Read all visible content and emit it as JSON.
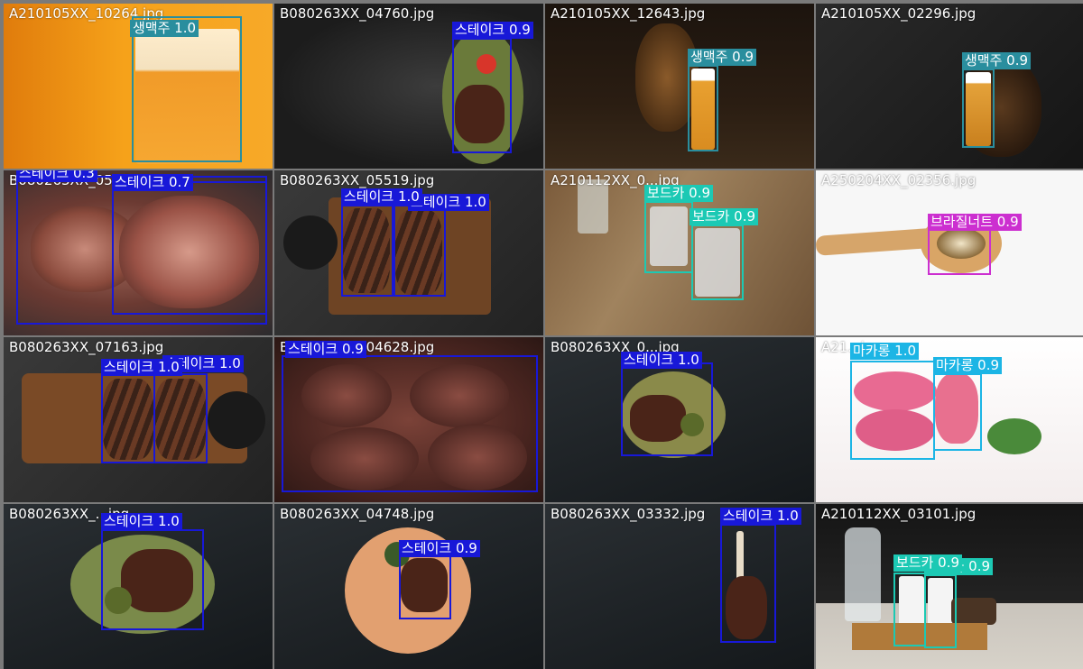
{
  "colors": {
    "beer": "#2a8e9e",
    "steak": "#1818d8",
    "vodka": "#1cc9b4",
    "brazilnut": "#cc2fd0",
    "macaron": "#1cb5e5"
  },
  "cells": [
    {
      "filename": "A210105XX_10264.jpg",
      "detections": [
        {
          "label": "생맥주 1.0"
        }
      ]
    },
    {
      "filename": "B080263XX_04760.jpg",
      "detections": [
        {
          "label": "스테이크 0.9"
        }
      ]
    },
    {
      "filename": "A210105XX_12643.jpg",
      "detections": [
        {
          "label": "생맥주 0.9"
        }
      ]
    },
    {
      "filename": "A210105XX_02296.jpg",
      "detections": [
        {
          "label": "생맥주 0.9"
        }
      ]
    },
    {
      "filename": "B080263XX_05...jpg",
      "detections": [
        {
          "label": "스테이크 0.3"
        },
        {
          "label": "스테이크 0.7"
        }
      ]
    },
    {
      "filename": "B080263XX_05519.jpg",
      "detections": [
        {
          "label": "스테이크 1.0"
        },
        {
          "label": "스테이크 1.0"
        }
      ]
    },
    {
      "filename": "A210112XX_0...jpg",
      "detections": [
        {
          "label": "보드카 0.9"
        },
        {
          "label": "보드카 0.9"
        }
      ]
    },
    {
      "filename": "A250204XX_02356.jpg",
      "detections": [
        {
          "label": "브라질너트 0.9"
        }
      ]
    },
    {
      "filename": "B080263XX_07163.jpg",
      "detections": [
        {
          "label": "스테이크 1.0"
        },
        {
          "label": "스테이크 1.0"
        }
      ]
    },
    {
      "filename": "B080263XX_04628.jpg",
      "detections": [
        {
          "label": "스테이크 0.9"
        }
      ]
    },
    {
      "filename": "B080263XX_0...jpg",
      "detections": [
        {
          "label": "스테이크 1.0"
        }
      ]
    },
    {
      "filename": "A21...jpg",
      "detections": [
        {
          "label": "마카롱 1.0"
        },
        {
          "label": "마카롱 0.9"
        }
      ]
    },
    {
      "filename": "B080263XX_...jpg",
      "detections": [
        {
          "label": "스테이크 1.0"
        }
      ]
    },
    {
      "filename": "B080263XX_04748.jpg",
      "detections": [
        {
          "label": "스테이크 0.9"
        }
      ]
    },
    {
      "filename": "B080263XX_03332.jpg",
      "detections": [
        {
          "label": "스테이크 1.0"
        }
      ]
    },
    {
      "filename": "A210112XX_03101.jpg",
      "detections": [
        {
          "label": "보드카 0.9"
        },
        {
          "label": "보드카 0.9"
        }
      ]
    }
  ]
}
